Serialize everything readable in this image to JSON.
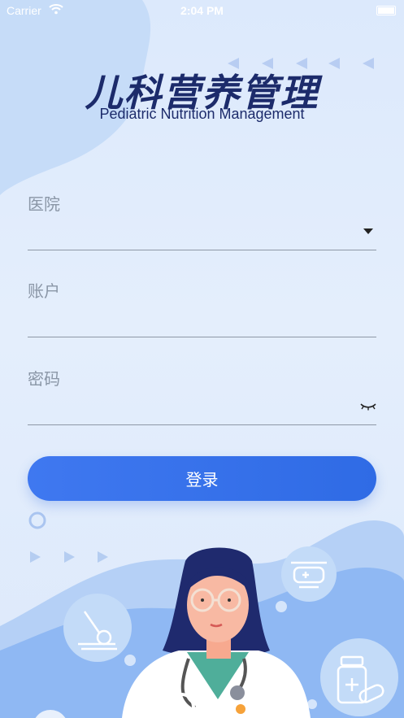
{
  "status_bar": {
    "carrier": "Carrier",
    "time": "2:04 PM"
  },
  "logo": {
    "title_cn": "儿科营养管理",
    "title_en": "Pediatric Nutrition Management"
  },
  "form": {
    "hospital": {
      "label": "医院",
      "value": ""
    },
    "account": {
      "label": "账户",
      "value": ""
    },
    "password": {
      "label": "密码",
      "value": ""
    },
    "login_label": "登录"
  },
  "colors": {
    "primary": "#2f6be5",
    "title": "#1c2b6b",
    "label": "#8a96a6"
  }
}
